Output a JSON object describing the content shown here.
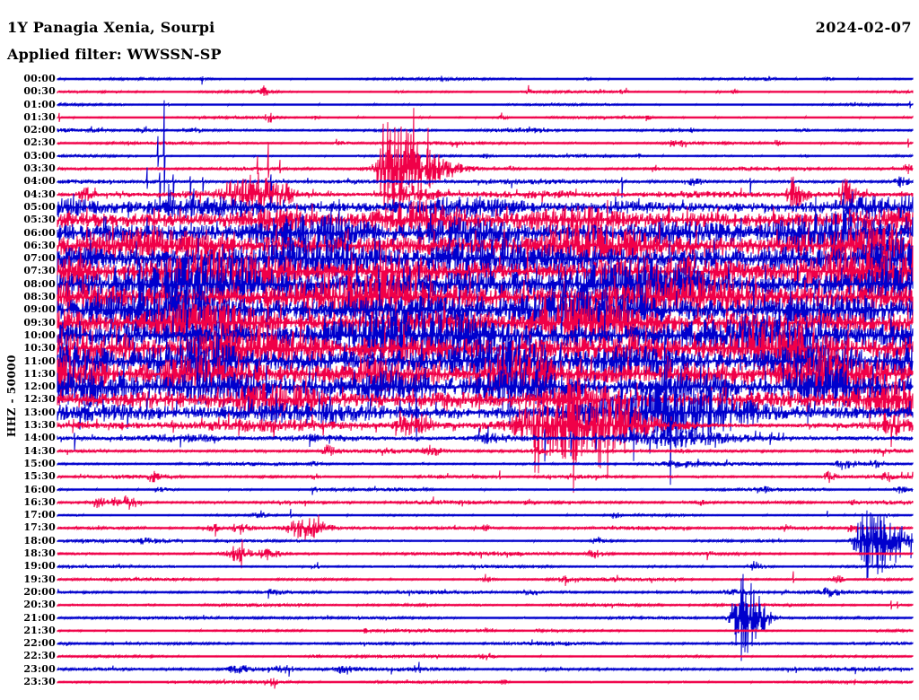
{
  "header": {
    "station_title": "1Y Panagia Xenia, Sourpi",
    "filter_label": "Applied filter: WWSSN-SP",
    "date": "2024-02-07"
  },
  "axis": {
    "scale_label": "HHZ - 50000"
  },
  "colors": {
    "trace_blue": "#0000cd",
    "trace_red": "#f00048",
    "text": "#000000",
    "background": "#ffffff"
  },
  "chart_data": {
    "type": "line",
    "subtype": "helicorder-day-plot",
    "title": "1Y Panagia Xenia, Sourpi",
    "subtitle": "Applied filter: WWSSN-SP",
    "date_label": "2024-02-07",
    "ylabel": "HHZ - 50000",
    "legend_position": "none",
    "grid": false,
    "row_minutes": 30,
    "notes": "48 half-hour traces, alternating blue (HH:00) and red (HH:30); heavy saturated noise band ~05:00-13:00; discrete events at 03:30 (red burst ~39% across), 18:00 (blue spindle ~95%), 21:00 (blue spindle ~80%)",
    "rows": [
      {
        "t": "00:00",
        "c": "b",
        "a": 0.7,
        "ev": [
          [
            0.17,
            2,
            5,
            1.3
          ],
          [
            0.45,
            2,
            4,
            1.3
          ],
          [
            0.62,
            2,
            4,
            1.1
          ],
          [
            0.83,
            3,
            6,
            1.5
          ],
          [
            0.9,
            2,
            4,
            1.3
          ]
        ]
      },
      {
        "t": "00:30",
        "c": "r",
        "a": 0.7,
        "ev": [
          [
            0.24,
            3,
            7,
            2.6
          ],
          [
            0.4,
            2,
            4,
            1.2
          ],
          [
            0.55,
            2,
            5,
            1.5
          ],
          [
            0.66,
            2,
            4,
            1.4
          ],
          [
            0.79,
            2,
            4,
            1.3
          ]
        ]
      },
      {
        "t": "01:00",
        "c": "b",
        "a": 0.6,
        "ev": [
          [
            0.93,
            2,
            4,
            1.4
          ]
        ],
        "sp": [
          [
            0.997,
            4,
            4
          ],
          [
            0.13,
            2,
            2
          ]
        ]
      },
      {
        "t": "01:30",
        "c": "r",
        "a": 0.7,
        "ev": [
          [
            0.247,
            3,
            6,
            3
          ],
          [
            0.3,
            2,
            4,
            1.5
          ],
          [
            0.52,
            2,
            4,
            1.5
          ],
          [
            0.69,
            2,
            4,
            1.2
          ]
        ],
        "sp": [
          [
            0.002,
            5,
            5
          ]
        ]
      },
      {
        "t": "02:00",
        "c": "b",
        "a": 1.0,
        "ev": [
          [
            0.04,
            3,
            6,
            1.6
          ],
          [
            0.1,
            5,
            9,
            1.8
          ],
          [
            0.16,
            3,
            7,
            1.5
          ],
          [
            0.42,
            2,
            4,
            1.2
          ],
          [
            0.56,
            3,
            6,
            1.5
          ],
          [
            0.74,
            2,
            5,
            1.5
          ],
          [
            0.87,
            2,
            4,
            1.2
          ]
        ]
      },
      {
        "t": "02:30",
        "c": "r",
        "a": 1.0,
        "ev": [
          [
            0.33,
            3,
            7,
            2
          ],
          [
            0.72,
            3,
            7,
            2.4
          ],
          [
            0.84,
            2,
            5,
            1.6
          ],
          [
            0.93,
            2,
            4,
            1.4
          ]
        ],
        "sp": [
          [
            0.995,
            5,
            5
          ]
        ]
      },
      {
        "t": "03:00",
        "c": "b",
        "a": 0.8,
        "ev": [
          [
            0.5,
            3,
            6,
            1.5
          ],
          [
            0.68,
            2,
            4,
            1.3
          ],
          [
            0.87,
            2,
            4,
            1.3
          ]
        ],
        "sp": [
          [
            0.125,
            62,
            45
          ],
          [
            0.118,
            22,
            12
          ]
        ]
      },
      {
        "t": "03:30",
        "c": "r",
        "a": 1.3,
        "ev": [
          [
            0.385,
            7,
            38,
            30
          ],
          [
            0.53,
            2,
            4,
            2
          ],
          [
            0.7,
            3,
            5,
            2
          ],
          [
            0.995,
            4,
            3,
            3.5
          ]
        ],
        "sp": [
          [
            0.386,
            52,
            24
          ],
          [
            0.247,
            30,
            10
          ],
          [
            0.234,
            14,
            6
          ],
          [
            0.26,
            10,
            5
          ]
        ]
      },
      {
        "t": "04:00",
        "c": "b",
        "a": 1.7,
        "ev": [
          [
            0.74,
            6,
            12,
            2.2
          ],
          [
            0.985,
            4,
            7,
            3
          ]
        ],
        "sp": [
          [
            0.105,
            16,
            8
          ],
          [
            0.12,
            10,
            34
          ],
          [
            0.135,
            8,
            28
          ],
          [
            0.155,
            6,
            20
          ],
          [
            0.17,
            5,
            14
          ],
          [
            0.25,
            8,
            24
          ],
          [
            0.66,
            5,
            18
          ],
          [
            0.81,
            4,
            14
          ],
          [
            0.86,
            4,
            11
          ]
        ]
      },
      {
        "t": "04:30",
        "c": "r",
        "a": 2.6,
        "seg": [
          [
            0.4,
            1,
            3.4
          ]
        ],
        "ev": [
          [
            0.03,
            4,
            9,
            4.5
          ],
          [
            0.21,
            9,
            16,
            8
          ],
          [
            0.235,
            7,
            13,
            10
          ],
          [
            0.26,
            5,
            11,
            6
          ],
          [
            0.4,
            12,
            28,
            5
          ],
          [
            0.86,
            4,
            9,
            12
          ],
          [
            0.92,
            4,
            9,
            9
          ]
        ]
      },
      {
        "t": "05:00",
        "c": "b",
        "a": 6.5,
        "seg": [
          [
            0,
            0.25,
            8.5
          ]
        ],
        "sp": [
          [
            0.13,
            26,
            12
          ],
          [
            0.16,
            21,
            9
          ]
        ]
      },
      {
        "t": "05:30",
        "c": "r",
        "a": 10
      },
      {
        "t": "06:00",
        "c": "b",
        "a": 12,
        "sp": [
          [
            0.32,
            32,
            30
          ]
        ]
      },
      {
        "t": "06:30",
        "c": "r",
        "a": 12
      },
      {
        "t": "07:00",
        "c": "b",
        "a": 14
      },
      {
        "t": "07:30",
        "c": "r",
        "a": 13,
        "sp": [
          [
            0.55,
            30,
            28
          ]
        ]
      },
      {
        "t": "08:00",
        "c": "b",
        "a": 15,
        "sp": [
          [
            0.35,
            30,
            28
          ]
        ]
      },
      {
        "t": "08:30",
        "c": "r",
        "a": 13.5
      },
      {
        "t": "09:00",
        "c": "b",
        "a": 15,
        "sp": [
          [
            0.47,
            32,
            26
          ]
        ]
      },
      {
        "t": "09:30",
        "c": "r",
        "a": 13.5
      },
      {
        "t": "10:00",
        "c": "b",
        "a": 15,
        "sp": [
          [
            0.64,
            30,
            32
          ]
        ]
      },
      {
        "t": "10:30",
        "c": "r",
        "a": 13.5
      },
      {
        "t": "11:00",
        "c": "b",
        "a": 15,
        "sp": [
          [
            0.71,
            32,
            30
          ]
        ]
      },
      {
        "t": "11:30",
        "c": "r",
        "a": 13.5
      },
      {
        "t": "12:00",
        "c": "b",
        "a": 13,
        "sp": [
          [
            0.245,
            27,
            32
          ],
          [
            0.71,
            42,
            46
          ]
        ]
      },
      {
        "t": "12:30",
        "c": "r",
        "a": 9.5
      },
      {
        "t": "13:00",
        "c": "b",
        "a": 8.5,
        "ev": [
          [
            0.71,
            35,
            55,
            13
          ]
        ],
        "sp": [
          [
            0.42,
            26,
            32
          ]
        ]
      },
      {
        "t": "13:30",
        "c": "r",
        "a": 4.5,
        "seg": [
          [
            0.75,
            1,
            3
          ]
        ],
        "ev": [
          [
            0.565,
            18,
            35,
            15
          ],
          [
            0.61,
            14,
            28,
            13
          ],
          [
            0.655,
            10,
            22,
            11
          ],
          [
            0.41,
            8,
            16,
            6
          ],
          [
            0.97,
            6,
            14,
            5
          ]
        ]
      },
      {
        "t": "14:00",
        "c": "b",
        "a": 2.8,
        "ev": [
          [
            0.73,
            28,
            48,
            4
          ],
          [
            0.5,
            8,
            16,
            2.5
          ]
        ],
        "sp": [
          [
            0.717,
            28,
            52
          ],
          [
            0.57,
            10,
            26
          ],
          [
            0.6,
            8,
            20
          ],
          [
            0.63,
            6,
            16
          ],
          [
            0.02,
            6,
            14
          ]
        ]
      },
      {
        "t": "14:30",
        "c": "r",
        "a": 1.4,
        "ev": [
          [
            0.315,
            4,
            9,
            4
          ],
          [
            0.435,
            5,
            11,
            3
          ],
          [
            0.56,
            3,
            6,
            2
          ],
          [
            0.73,
            3,
            6,
            1.6
          ]
        ]
      },
      {
        "t": "15:00",
        "c": "b",
        "a": 1.0,
        "ev": [
          [
            0.72,
            16,
            28,
            1.6
          ],
          [
            0.92,
            7,
            13,
            3
          ],
          [
            0.955,
            5,
            10,
            2.5
          ],
          [
            0.3,
            3,
            6,
            1.3
          ]
        ]
      },
      {
        "t": "15:30",
        "c": "r",
        "a": 1.1,
        "ev": [
          [
            0.11,
            3,
            7,
            3
          ],
          [
            0.3,
            2,
            5,
            2
          ],
          [
            0.6,
            2,
            5,
            2
          ],
          [
            0.9,
            3,
            7,
            4
          ],
          [
            0.97,
            3,
            6,
            3
          ]
        ],
        "sp": [
          [
            0.517,
            7,
            3
          ]
        ]
      },
      {
        "t": "16:00",
        "c": "b",
        "a": 0.8,
        "ev": [
          [
            0.12,
            4,
            9,
            1.6
          ],
          [
            0.3,
            3,
            7,
            1.5
          ],
          [
            0.82,
            5,
            9,
            2
          ],
          [
            0.985,
            3,
            6,
            3
          ]
        ]
      },
      {
        "t": "16:30",
        "c": "r",
        "a": 1.3,
        "ev": [
          [
            0.044,
            4,
            8,
            3.5
          ],
          [
            0.065,
            5,
            10,
            4
          ],
          [
            0.082,
            4,
            8,
            3.5
          ],
          [
            0.55,
            3,
            6,
            2
          ],
          [
            0.75,
            3,
            6,
            2
          ],
          [
            0.93,
            2,
            5,
            1.5
          ]
        ]
      },
      {
        "t": "17:00",
        "c": "b",
        "a": 0.7,
        "ev": [
          [
            0.235,
            3,
            6,
            2
          ],
          [
            0.65,
            2,
            5,
            2
          ],
          [
            0.97,
            2,
            5,
            2.2
          ]
        ],
        "sp": [
          [
            0.273,
            7,
            3
          ],
          [
            0.9,
            5,
            2
          ]
        ]
      },
      {
        "t": "17:30",
        "c": "r",
        "a": 1.3,
        "ev": [
          [
            0.283,
            8,
            20,
            7.5
          ],
          [
            0.21,
            5,
            11,
            3
          ],
          [
            0.18,
            4,
            9,
            3
          ],
          [
            0.93,
            3,
            7,
            3
          ],
          [
            0.5,
            3,
            6,
            2
          ]
        ]
      },
      {
        "t": "18:00",
        "c": "b",
        "a": 0.8,
        "ev": [
          [
            0.104,
            12,
            22,
            1.8
          ],
          [
            0.63,
            3,
            6,
            3
          ],
          [
            0.947,
            9,
            28,
            24
          ]
        ],
        "sp": [
          [
            0.947,
            34,
            44
          ]
        ]
      },
      {
        "t": "18:30",
        "c": "r",
        "a": 1.1,
        "ev": [
          [
            0.206,
            7,
            14,
            5.5
          ],
          [
            0.245,
            4,
            9,
            4
          ],
          [
            0.625,
            4,
            9,
            3
          ],
          [
            0.76,
            2,
            5,
            1.6
          ]
        ]
      },
      {
        "t": "19:00",
        "c": "b",
        "a": 0.9,
        "ev": [
          [
            0.815,
            4,
            9,
            3.5
          ],
          [
            0.3,
            2,
            5,
            1.1
          ]
        ]
      },
      {
        "t": "19:30",
        "c": "r",
        "a": 1.0,
        "ev": [
          [
            0.5,
            3,
            7,
            2
          ],
          [
            0.59,
            3,
            7,
            2
          ],
          [
            0.91,
            3,
            6,
            3
          ]
        ],
        "sp": [
          [
            0.86,
            9,
            4
          ]
        ]
      },
      {
        "t": "20:00",
        "c": "b",
        "a": 1.2,
        "ev": [
          [
            0.25,
            5,
            10,
            1.6
          ],
          [
            0.55,
            5,
            10,
            1.6
          ],
          [
            0.79,
            7,
            14,
            2.2
          ],
          [
            0.9,
            5,
            10,
            2
          ]
        ]
      },
      {
        "t": "20:30",
        "c": "r",
        "a": 1.0,
        "sp": [
          [
            0.975,
            5,
            5
          ],
          [
            0.982,
            4,
            4
          ]
        ]
      },
      {
        "t": "21:00",
        "c": "b",
        "a": 0.9,
        "seg": [
          [
            0,
            0.3,
            1.4
          ]
        ],
        "ev": [
          [
            0.8,
            7,
            16,
            30
          ]
        ],
        "sp": [
          [
            0.8,
            44,
            48
          ]
        ]
      },
      {
        "t": "21:30",
        "c": "r",
        "a": 0.8,
        "ev": [
          [
            0.36,
            2,
            5,
            2
          ],
          [
            0.5,
            3,
            6,
            2
          ],
          [
            0.56,
            2,
            4,
            1.5
          ]
        ]
      },
      {
        "t": "22:00",
        "c": "b",
        "a": 1.2
      },
      {
        "t": "22:30",
        "c": "r",
        "a": 0.8,
        "ev": [
          [
            0.5,
            3,
            7,
            2.5
          ],
          [
            0.3,
            2,
            4,
            1.5
          ]
        ]
      },
      {
        "t": "23:00",
        "c": "b",
        "a": 1.3,
        "ev": [
          [
            0.21,
            9,
            17,
            2.6
          ],
          [
            0.26,
            7,
            13,
            2.6
          ],
          [
            0.33,
            5,
            11,
            2
          ],
          [
            0.42,
            4,
            9,
            1.6
          ]
        ]
      },
      {
        "t": "23:30",
        "c": "r",
        "a": 0.8,
        "ev": [
          [
            0.25,
            3,
            7,
            2
          ],
          [
            0.52,
            2,
            5,
            1.5
          ]
        ]
      }
    ]
  }
}
